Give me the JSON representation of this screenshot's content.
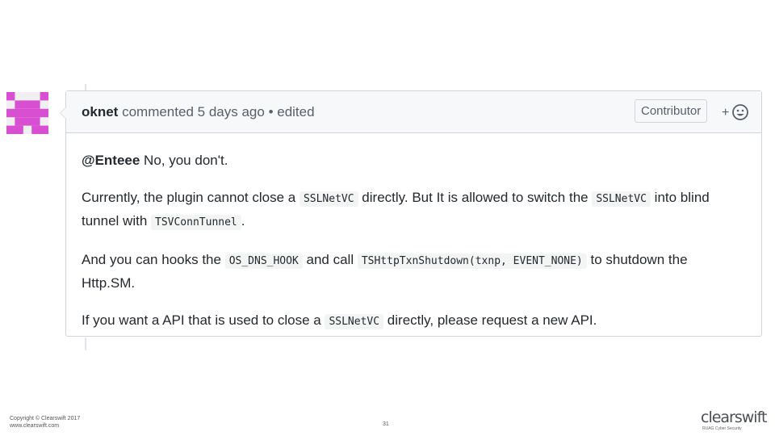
{
  "comment": {
    "author": "oknet",
    "action": "commented",
    "time": "5 days ago",
    "separator": "•",
    "edited": "edited",
    "badge": "Contributor",
    "reaction_plus": "+"
  },
  "body": {
    "p1": {
      "mention": "@Enteee",
      "text": " No, you don't."
    },
    "p2": {
      "t1": "Currently, the plugin cannot close a ",
      "c1": "SSLNetVC",
      "t2": " directly. But It is allowed to switch the ",
      "c2": "SSLNetVC",
      "t3": " into blind tunnel with ",
      "c3": "TSVConnTunnel",
      "t4": "."
    },
    "p3": {
      "t1": "And you can hooks the ",
      "c1": "OS_DNS_HOOK",
      "t2": " and call ",
      "c2": "TSHttpTxnShutdown(txnp, EVENT_NONE)",
      "t3": " to shutdown the Http.SM."
    },
    "p4": {
      "t1": "If you want a API that is used to close a ",
      "c1": "SSLNetVC",
      "t2": " directly, please request a new API."
    }
  },
  "footer": {
    "copyright": "Copyright © Clearswift 2017",
    "website": "www.clearswift.com",
    "page_number": "31",
    "logo_text": "clearswift",
    "logo_tagline": "RUAG Cyber Security"
  },
  "colors": {
    "avatar": "#d84fd1",
    "header_bg": "#f6f8fa",
    "border": "#d1d5da"
  },
  "icons": {
    "reaction": "smiley-icon"
  }
}
